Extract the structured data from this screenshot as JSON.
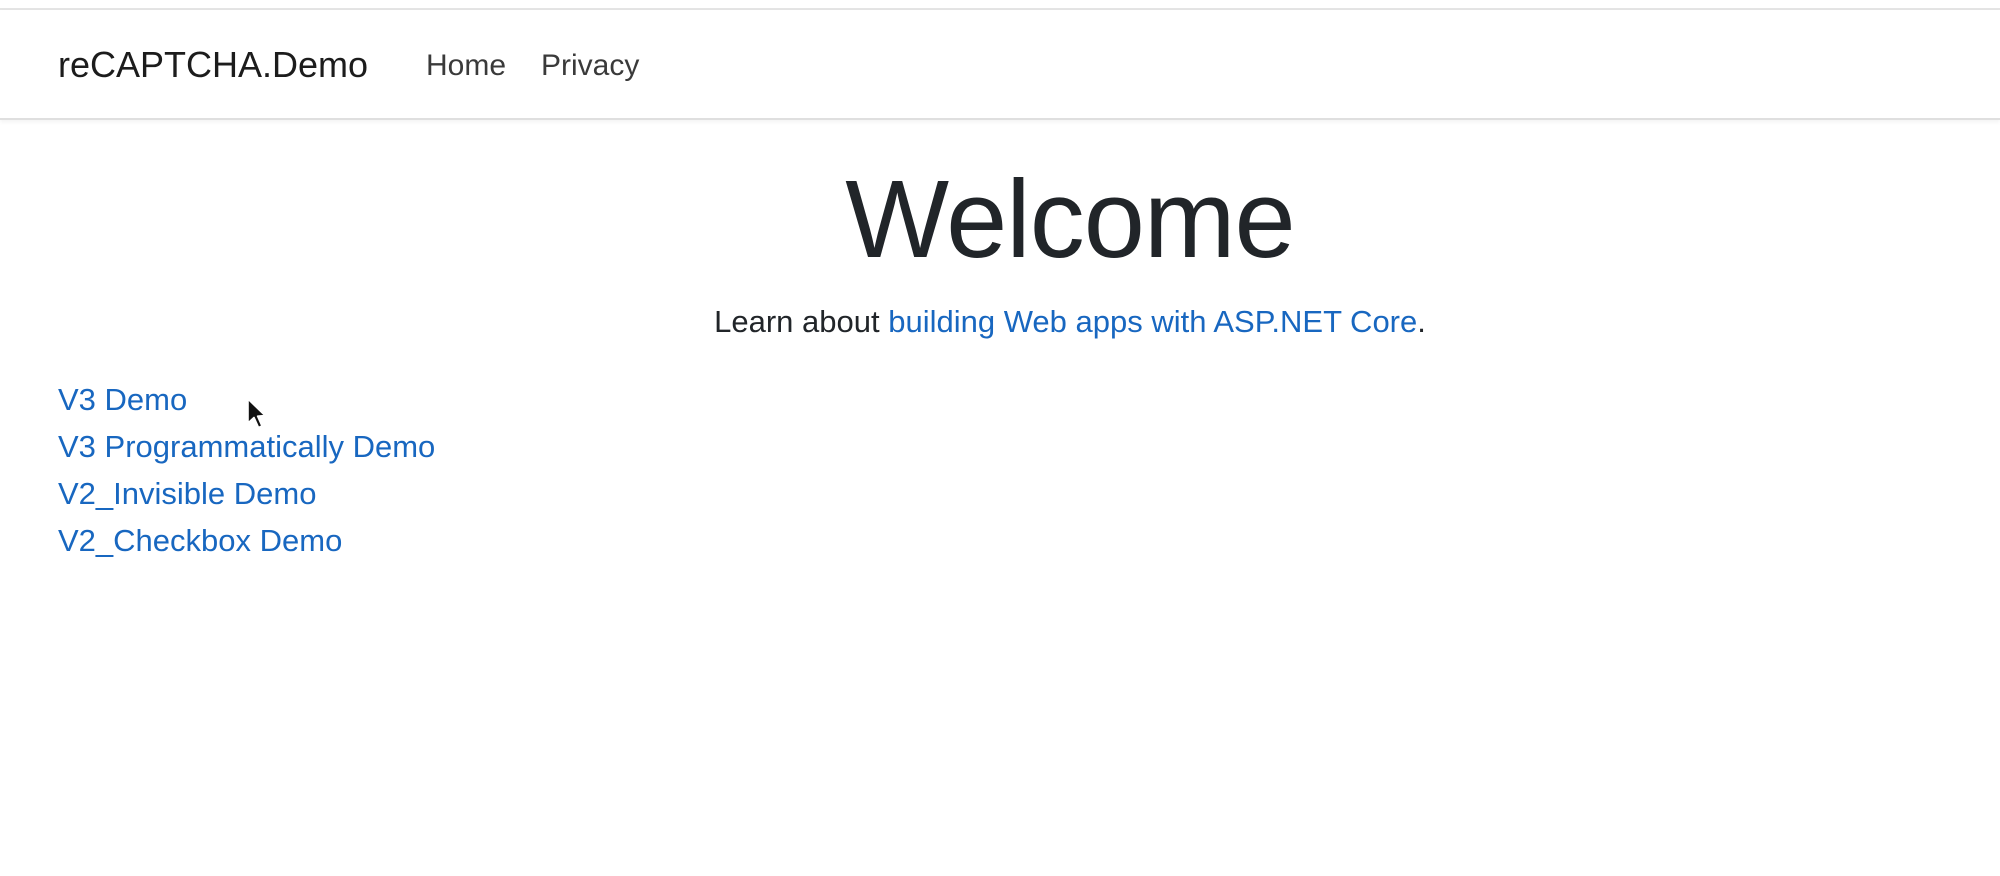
{
  "navbar": {
    "brand": "reCAPTCHA.Demo",
    "links": [
      {
        "label": "Home"
      },
      {
        "label": "Privacy"
      }
    ]
  },
  "main": {
    "title": "Welcome",
    "learn_prefix": "Learn about ",
    "learn_link": "building Web apps with ASP.NET Core",
    "learn_suffix": ".",
    "demos": [
      {
        "label": "V3 Demo"
      },
      {
        "label": "V3 Programmatically Demo"
      },
      {
        "label": "V2_Invisible Demo"
      },
      {
        "label": "V2_Checkbox Demo"
      }
    ]
  },
  "colors": {
    "link": "#1867c0",
    "text": "#212529",
    "navbar_border": "#dfdfdf"
  },
  "icons": {
    "cursor": "mouse-pointer-icon"
  }
}
